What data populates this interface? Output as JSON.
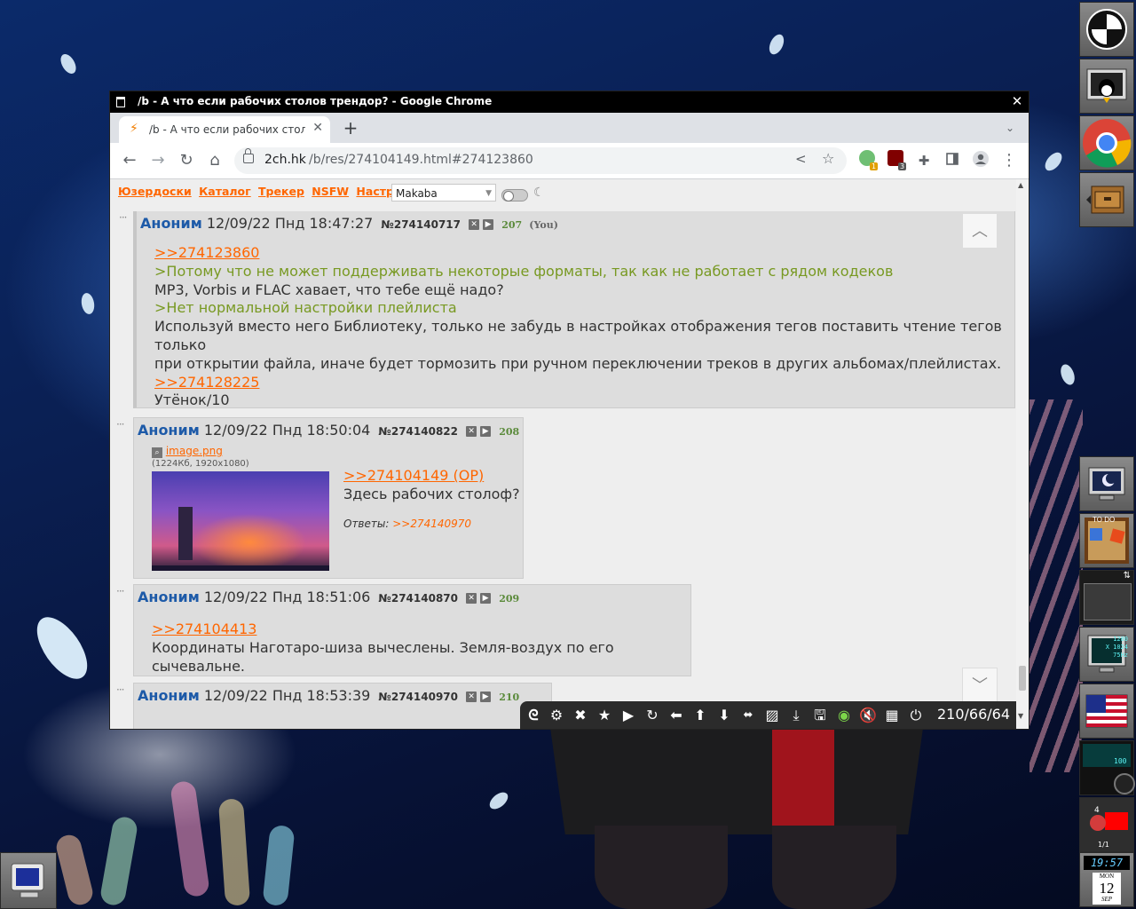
{
  "window": {
    "title": "/b - А что если рабочих столов трендор? - Google Chrome",
    "close_glyph": "✕"
  },
  "tab": {
    "title": "/b - А что если рабочих столов трендор?",
    "close_glyph": "✕",
    "new_tab_glyph": "+",
    "search_glyph": "⌄"
  },
  "toolbar": {
    "back_glyph": "←",
    "forward_glyph": "→",
    "reload_glyph": "↻",
    "home_glyph": "⌂",
    "url_domain": "2ch.hk",
    "url_path": "/b/res/274104149.html#274123860",
    "extension_badges": [
      "1",
      "3"
    ],
    "menu_glyph": "⋮"
  },
  "nav": {
    "links": [
      "Юзердоски",
      "Каталог",
      "Трекер",
      "NSFW",
      "Настройки"
    ],
    "style_value": "Makaba"
  },
  "posts": [
    {
      "name": "Аноним",
      "date": "12/09/22 Пнд 18:47:27",
      "num": "№274140717",
      "count": "207",
      "you": "(You)",
      "lines": [
        {
          "type": "reply",
          "text": ">>274123860"
        },
        {
          "type": "quote",
          "text": ">Потому что не может поддерживать некоторые форматы, так как не работает с рядом кодеков"
        },
        {
          "type": "text",
          "text": "MP3, Vorbis и FLAC хавает, что тебе ещё надо?"
        },
        {
          "type": "quote",
          "text": ">Нет нормальной настройки плейлиста"
        },
        {
          "type": "text",
          "text": "Используй вместо него Библиотеку, только не забудь в настройках отображения тегов поставить чтение тегов только"
        },
        {
          "type": "text",
          "text": "при открытии файла, иначе будет тормозить при ручном переключении треков в других альбомах/плейлистах."
        },
        {
          "type": "reply",
          "text": ">>274128225"
        },
        {
          "type": "text",
          "text": "Утёнок/10"
        }
      ]
    },
    {
      "name": "Аноним",
      "date": "12/09/22 Пнд 18:50:04",
      "num": "№274140822",
      "count": "208",
      "file_name": "image.png",
      "file_meta": "(1224Кб, 1920x1080)",
      "reply_link": ">>274104149 (OP)",
      "text": "Здесь рабочих столоф?",
      "answers_label": "Ответы:",
      "answers_link": ">>274140970"
    },
    {
      "name": "Аноним",
      "date": "12/09/22 Пнд 18:51:06",
      "num": "№274140870",
      "count": "209",
      "reply_link": ">>274104413",
      "text": "Координаты Наготаро-шиза вычеслены. Земля-воздух по его сычевальне."
    },
    {
      "name": "Аноним",
      "date": "12/09/22 Пнд 18:53:39",
      "num": "№274140970",
      "count": "210"
    }
  ],
  "panel": {
    "counter": "210/66/64"
  },
  "dock": {
    "clock_time": "19:57",
    "cal_day": "MON",
    "cal_date": "12",
    "cal_month": "SEP",
    "todo_label": "TO DO",
    "monitor_readout": [
      "1280",
      "X 1024",
      "75Hz"
    ],
    "volume_value": "100",
    "pager": "1/1",
    "notify_count": "4"
  },
  "colors": {
    "accent_link": "#ff6600",
    "quote_green": "#789922",
    "name_blue": "#1d5aa8",
    "post_bg": "#dddddd",
    "page_bg": "#eeeeee"
  }
}
